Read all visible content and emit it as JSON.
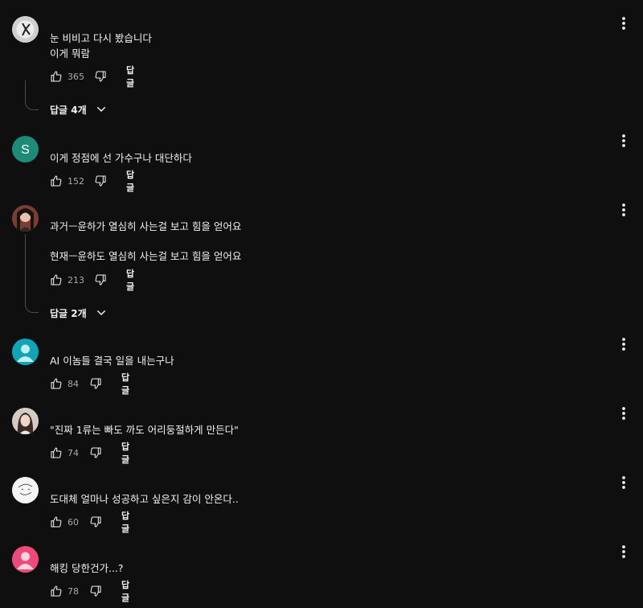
{
  "comments": [
    {
      "lines": [
        "눈 비비고 다시 봤습니다",
        "이게 뭐람"
      ],
      "likes": "365",
      "reply_label": "답글",
      "replies_label": "답글 4개",
      "avatar": {
        "type": "logo",
        "bg": "#d9d9d9"
      }
    },
    {
      "lines": [
        "이게 정점에 선 가수구나 대단하다"
      ],
      "likes": "152",
      "reply_label": "답글",
      "avatar": {
        "type": "letter",
        "letter": "S",
        "bg": "#1e8a78"
      }
    },
    {
      "lines": [
        "과거ㅡ윤하가 열심히 사는걸 보고 힘을 얻어요",
        "현재ㅡ윤하도 열심히 사는걸 보고 힘을 얻어요"
      ],
      "likes": "213",
      "reply_label": "답글",
      "replies_label": "답글 2개",
      "avatar": {
        "type": "photo",
        "bg": "#6b3b2f"
      }
    },
    {
      "lines": [
        "AI 이놈들 결국 일을 내는구나"
      ],
      "likes": "84",
      "reply_label": "답글",
      "avatar": {
        "type": "person",
        "bg": "#12a3b5"
      }
    },
    {
      "lines": [
        "\"진짜 1류는 빠도 까도 어리둥절하게 만든다\""
      ],
      "likes": "74",
      "reply_label": "답글",
      "avatar": {
        "type": "photo",
        "bg": "#c9bcb3"
      }
    },
    {
      "lines": [
        "도대체 얼마나 성공하고 싶은지 감이 안온다.."
      ],
      "likes": "60",
      "reply_label": "답글",
      "avatar": {
        "type": "sketch",
        "bg": "#f2f2f2"
      }
    },
    {
      "lines": [
        "해킹 당한건가...?"
      ],
      "likes": "78",
      "reply_label": "답글",
      "avatar": {
        "type": "person",
        "bg": "#ec4a7a"
      }
    }
  ],
  "icons": {
    "like": "thumbs-up-icon",
    "dislike": "thumbs-down-icon",
    "more": "more-vert-icon",
    "chevron": "chevron-down-icon"
  }
}
